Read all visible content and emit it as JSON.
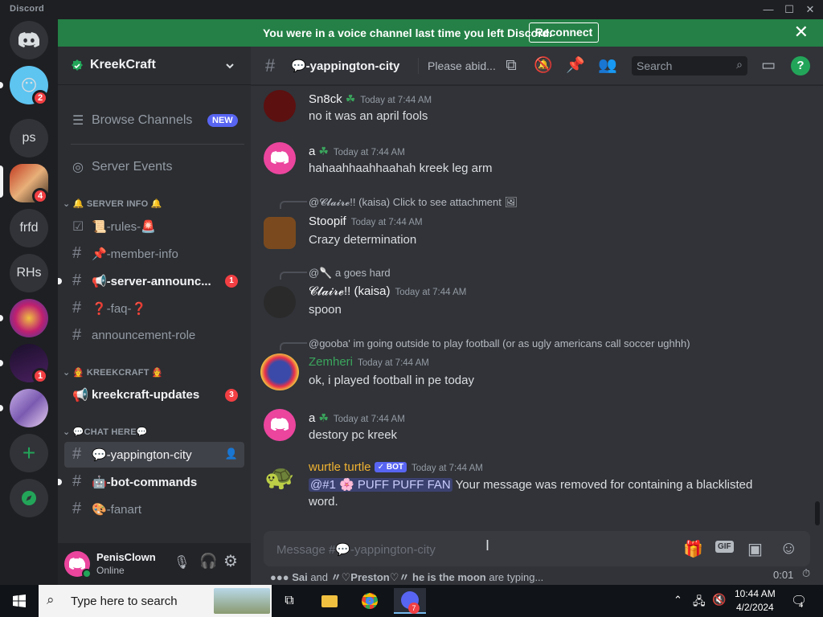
{
  "window": {
    "title": "Discord",
    "controls": {
      "minimize": "—",
      "maximize": "☐",
      "close": "✕"
    }
  },
  "banner": {
    "text": "You were in a voice channel last time you left Discord.",
    "button": "Reconnect",
    "close": "✕"
  },
  "servers": [
    {
      "label": "",
      "kind": "home",
      "badge": ""
    },
    {
      "label": "",
      "kind": "avatar",
      "badge": "2"
    },
    {
      "label": "ps",
      "kind": "text",
      "badge": ""
    },
    {
      "label": "",
      "kind": "image",
      "badge": "4"
    },
    {
      "label": "frfd",
      "kind": "text",
      "badge": ""
    },
    {
      "label": "RHs",
      "kind": "text",
      "badge": ""
    },
    {
      "label": "",
      "kind": "image",
      "badge": ""
    },
    {
      "label": "",
      "kind": "image",
      "badge": "1"
    },
    {
      "label": "",
      "kind": "image",
      "badge": ""
    },
    {
      "label": "+",
      "kind": "add",
      "badge": ""
    },
    {
      "label": "",
      "kind": "discover",
      "badge": ""
    }
  ],
  "sidebar": {
    "server_name": "KreekCraft",
    "browse_channels": "Browse Channels",
    "new_badge": "NEW",
    "server_events": "Server Events",
    "categories": [
      "🔔 SERVER INFO 🔔",
      "🧑‍🚒 KREEKCRAFT 🧑‍🚒",
      "💬CHAT HERE💬"
    ],
    "channels": [
      {
        "name": "📜-rules-🚨",
        "badge": "",
        "unread": false
      },
      {
        "name": "📌-member-info",
        "badge": "",
        "unread": false
      },
      {
        "name": "📢-server-announc...",
        "badge": "1",
        "unread": true
      },
      {
        "name": "❓-faq-❓",
        "badge": "",
        "unread": false
      },
      {
        "name": "announcement-role",
        "badge": "",
        "unread": false
      },
      {
        "name": "kreekcraft-updates",
        "badge": "3",
        "unread": true
      },
      {
        "name": "💬-yappington-city",
        "badge": "",
        "unread": false
      },
      {
        "name": "🤖-bot-commands",
        "badge": "",
        "unread": true
      },
      {
        "name": "🎨-fanart",
        "badge": "",
        "unread": false
      }
    ]
  },
  "user": {
    "name": "PenisClown",
    "status": "Online"
  },
  "channel_header": {
    "name": "💬-yappington-city",
    "topic": "Please abid...",
    "search_placeholder": "Search"
  },
  "messages": [
    {
      "author": "Sn8ck",
      "time": "Today at 7:44 AM",
      "text": "no it was an april fools",
      "reply": "",
      "author_color": "#f2f3f5",
      "avatar_color": "#5c1010"
    },
    {
      "author": "a",
      "time": "Today at 7:44 AM",
      "text": "hahaahhaahhaahah kreek leg arm",
      "reply": "",
      "author_color": "#f2f3f5",
      "avatar_color": "#eb459e"
    },
    {
      "author": "Stoopif",
      "time": "Today at 7:44 AM",
      "text": "Crazy determination",
      "reply": "@𝓒𝓵𝓪𝓲𝓻𝓮!! (kaisa) Click to see attachment",
      "author_color": "#f2f3f5",
      "avatar_color": "#7a4a1e"
    },
    {
      "author": "𝓒𝓵𝓪𝓲𝓻𝓮!! (kaisa)",
      "time": "Today at 7:44 AM",
      "text": "spoon",
      "reply": "@🥄 a goes hard",
      "author_color": "#f2f3f5",
      "avatar_color": "#2a2a2a"
    },
    {
      "author": "Zemheri",
      "time": "Today at 7:44 AM",
      "text": "ok, i played football in pe today",
      "reply": "@gooba' im going outside to play football (or as ugly americans call soccer ughhh)",
      "author_color": "#3ba55d",
      "avatar_color": "#3b4aa8"
    },
    {
      "author": "a",
      "time": "Today at 7:44 AM",
      "text": "destory pc kreek",
      "reply": "",
      "author_color": "#f2f3f5",
      "avatar_color": "#eb459e"
    },
    {
      "author": "wurtle turtle",
      "time": "Today at 7:44 AM",
      "text": "Your message was removed for containing a blacklisted",
      "text2": "word.",
      "mention": "@#1 🌸 PUFF PUFF FAN",
      "bot": "✓ BOT",
      "reply": "",
      "author_color": "#f0b232",
      "avatar_color": "#4a7a2a"
    }
  ],
  "composer": {
    "placeholder": "Message #💬-yappington-city"
  },
  "typing": {
    "text_a": "Sai",
    "and": "and",
    "text_b": "〃♡Preston♡〃",
    "text_c": "he is the moon",
    "suffix": "are typing...",
    "timer": "0:01"
  },
  "taskbar": {
    "search_placeholder": "Type here to search",
    "time": "10:44 AM",
    "date": "4/2/2024",
    "notif": "4",
    "discord_badge": "7"
  },
  "colors": {
    "brand": "#5865f2",
    "green": "#248046",
    "danger": "#f23f43"
  }
}
